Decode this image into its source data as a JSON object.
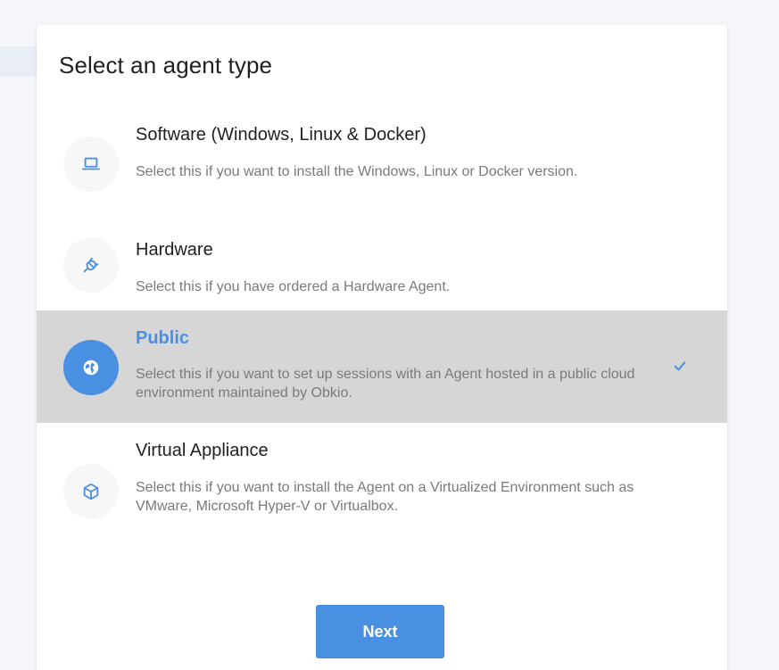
{
  "dialog": {
    "title": "Select an agent type",
    "next_label": "Next"
  },
  "options": [
    {
      "title": "Software (Windows, Linux & Docker)",
      "description": "Select this if you want to install the Windows, Linux or Docker version.",
      "icon": "laptop-icon",
      "selected": false
    },
    {
      "title": "Hardware",
      "description": "Select this if you have ordered a Hardware Agent.",
      "icon": "plug-icon",
      "selected": false
    },
    {
      "title": "Public",
      "description": "Select this if you want to set up sessions with an Agent hosted in a public cloud environment maintained by Obkio.",
      "icon": "globe-icon",
      "selected": true
    },
    {
      "title": "Virtual Appliance",
      "description": "Select this if you want to install the Agent on a Virtualized Environment such as VMware, Microsoft Hyper-V or Virtualbox.",
      "icon": "cube-icon",
      "selected": false
    }
  ],
  "colors": {
    "accent": "#4a90e2",
    "selected_row": "#d6d6d6",
    "muted_text": "#7a7a7a"
  }
}
